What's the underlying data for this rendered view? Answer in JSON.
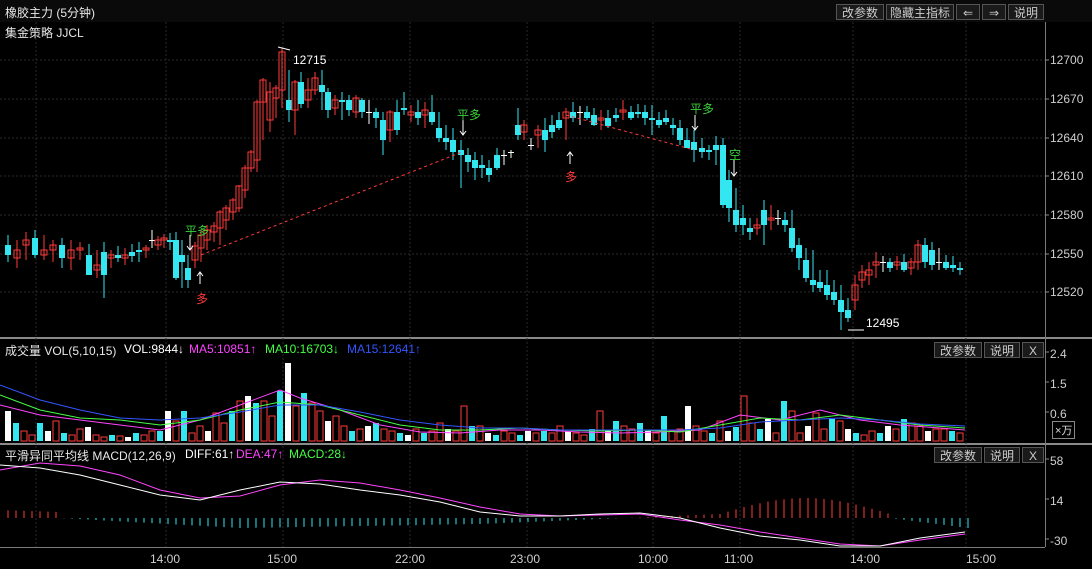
{
  "header": {
    "title": "橡胶主力 (5分钟)",
    "btn_params": "改参数",
    "btn_hide": "隐藏主指标",
    "btn_left": "⇐",
    "btn_right": "⇒",
    "btn_help": "说明"
  },
  "main_panel": {
    "strategy": "集金策略 JJCL",
    "yticks": [
      "12700",
      "12670",
      "12640",
      "12610",
      "12580",
      "12550",
      "12520"
    ],
    "high_label": "12715",
    "low_label": "12495",
    "signals": [
      {
        "text": "平多",
        "color": "#3ad13a"
      },
      {
        "text": "多",
        "color": "#ff3b3b"
      },
      {
        "text": "平多",
        "color": "#3ad13a"
      },
      {
        "text": "多",
        "color": "#ff3b3b"
      },
      {
        "text": "平多",
        "color": "#3ad13a"
      },
      {
        "text": "空",
        "color": "#3ad13a"
      }
    ]
  },
  "vol_panel": {
    "name": "成交量 VOL(5,10,15)",
    "vol": "VOL:9844↓",
    "ma5": "MA5:10851↑",
    "ma10": "MA10:16703↓",
    "ma15": "MA15:12641↑",
    "yticks": [
      "2.4",
      "1.5",
      "0.6"
    ],
    "unit": "×万",
    "btn_params": "改参数",
    "btn_help": "说明",
    "btn_close": "X"
  },
  "macd_panel": {
    "name": "平滑异同平均线 MACD(12,26,9)",
    "diff": "DIFF:61↑",
    "dea": "DEA:47↑",
    "macd": "MACD:28↓",
    "yticks": [
      "58",
      "14",
      "-30"
    ],
    "btn_params": "改参数",
    "btn_help": "说明",
    "btn_close": "X"
  },
  "xaxis": [
    "14:00",
    "15:00",
    "22:00",
    "23:00",
    "10:00",
    "11:00",
    "14:00",
    "15:00"
  ],
  "colors": {
    "up": "#ff3b3b",
    "down": "#33e6f0",
    "flat": "#ffffff",
    "ma5": "#ff44ff",
    "ma10": "#44ff44",
    "ma15": "#3355ff",
    "dea": "#ff44ff",
    "diff": "#ffffff"
  }
}
